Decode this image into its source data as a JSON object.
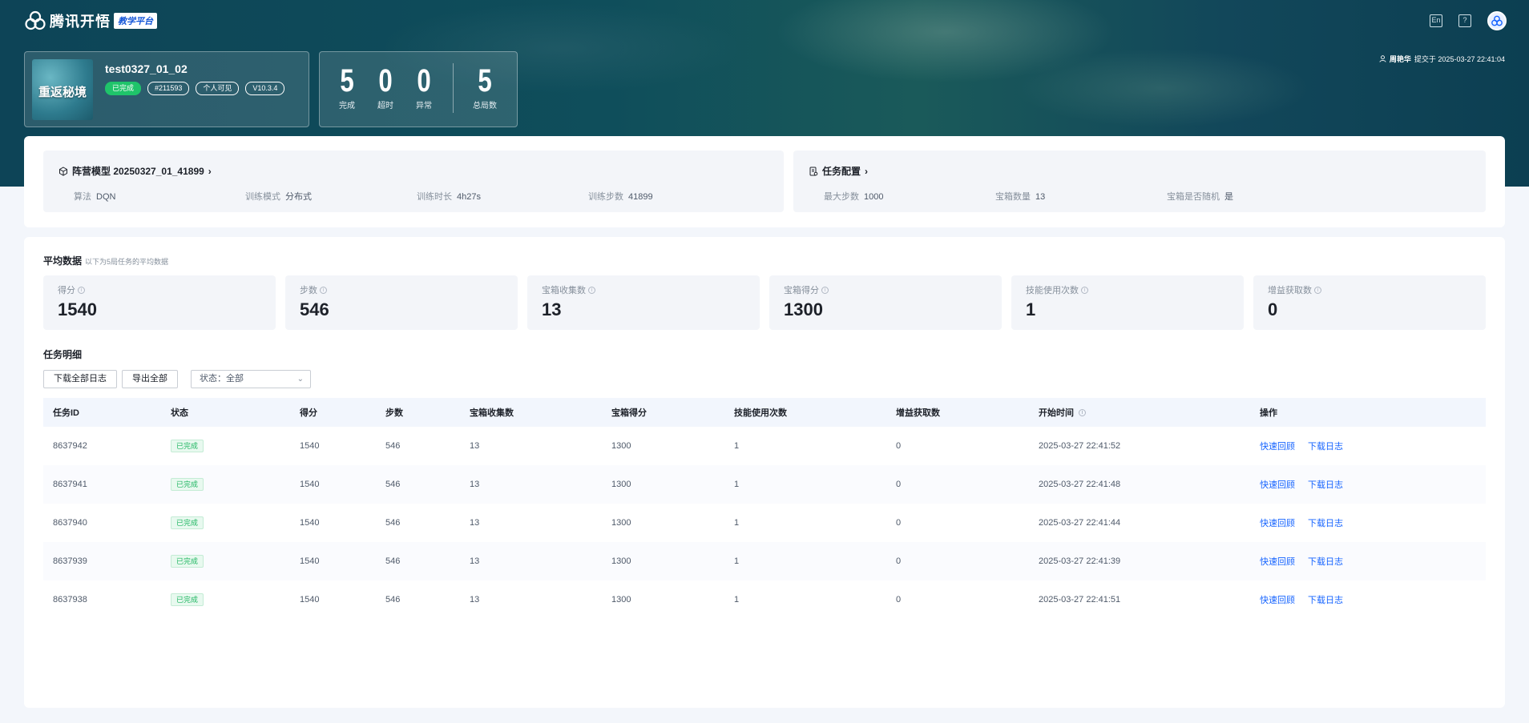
{
  "header": {
    "brand": "腾讯开悟",
    "brand_badge": "教学平台",
    "icons": [
      "translate-icon",
      "help-icon",
      "user-avatar"
    ]
  },
  "task": {
    "thumbnail_text": "重返秘境",
    "name": "test0327_01_02",
    "tags": [
      "已完成",
      "#211593",
      "个人可见",
      "V10.3.4"
    ]
  },
  "summary": {
    "items": [
      {
        "value": "5",
        "label": "完成"
      },
      {
        "value": "0",
        "label": "超时"
      },
      {
        "value": "0",
        "label": "异常"
      },
      {
        "value": "5",
        "label": "总局数"
      }
    ]
  },
  "submitter": {
    "name": "周艳华",
    "text": "提交于 2025-03-27 22:41:04"
  },
  "model": {
    "title": "阵营模型 20250327_01_41899",
    "fields": [
      {
        "key": "算法",
        "value": "DQN"
      },
      {
        "key": "训练模式",
        "value": "分布式"
      },
      {
        "key": "训练时长",
        "value": "4h27s"
      },
      {
        "key": "训练步数",
        "value": "41899"
      }
    ]
  },
  "config": {
    "title": "任务配置",
    "fields": [
      {
        "key": "最大步数",
        "value": "1000"
      },
      {
        "key": "宝箱数量",
        "value": "13"
      },
      {
        "key": "宝箱是否随机",
        "value": "是"
      }
    ]
  },
  "average": {
    "title": "平均数据",
    "subtitle": "以下为5局任务的平均数据",
    "metrics": [
      {
        "label": "得分",
        "value": "1540"
      },
      {
        "label": "步数",
        "value": "546"
      },
      {
        "label": "宝箱收集数",
        "value": "13"
      },
      {
        "label": "宝箱得分",
        "value": "1300"
      },
      {
        "label": "技能使用次数",
        "value": "1"
      },
      {
        "label": "增益获取数",
        "value": "0"
      }
    ]
  },
  "details": {
    "title": "任务明细",
    "download_all": "下载全部日志",
    "export_all": "导出全部",
    "status_filter": "状态：全部",
    "columns": [
      "任务ID",
      "状态",
      "得分",
      "步数",
      "宝箱收集数",
      "宝箱得分",
      "技能使用次数",
      "增益获取数",
      "开始时间",
      "操作"
    ],
    "rows": [
      {
        "id": "8637942",
        "status": "已完成",
        "score": "1540",
        "steps": "546",
        "chests": "13",
        "chest_score": "1300",
        "skills": "1",
        "buffs": "0",
        "start": "2025-03-27 22:41:52",
        "action1": "快速回顾",
        "action2": "下载日志"
      },
      {
        "id": "8637941",
        "status": "已完成",
        "score": "1540",
        "steps": "546",
        "chests": "13",
        "chest_score": "1300",
        "skills": "1",
        "buffs": "0",
        "start": "2025-03-27 22:41:48",
        "action1": "快速回顾",
        "action2": "下载日志"
      },
      {
        "id": "8637940",
        "status": "已完成",
        "score": "1540",
        "steps": "546",
        "chests": "13",
        "chest_score": "1300",
        "skills": "1",
        "buffs": "0",
        "start": "2025-03-27 22:41:44",
        "action1": "快速回顾",
        "action2": "下载日志"
      },
      {
        "id": "8637939",
        "status": "已完成",
        "score": "1540",
        "steps": "546",
        "chests": "13",
        "chest_score": "1300",
        "skills": "1",
        "buffs": "0",
        "start": "2025-03-27 22:41:39",
        "action1": "快速回顾",
        "action2": "下载日志"
      },
      {
        "id": "8637938",
        "status": "已完成",
        "score": "1540",
        "steps": "546",
        "chests": "13",
        "chest_score": "1300",
        "skills": "1",
        "buffs": "0",
        "start": "2025-03-27 22:41:51",
        "action1": "快速回顾",
        "action2": "下载日志"
      }
    ]
  }
}
